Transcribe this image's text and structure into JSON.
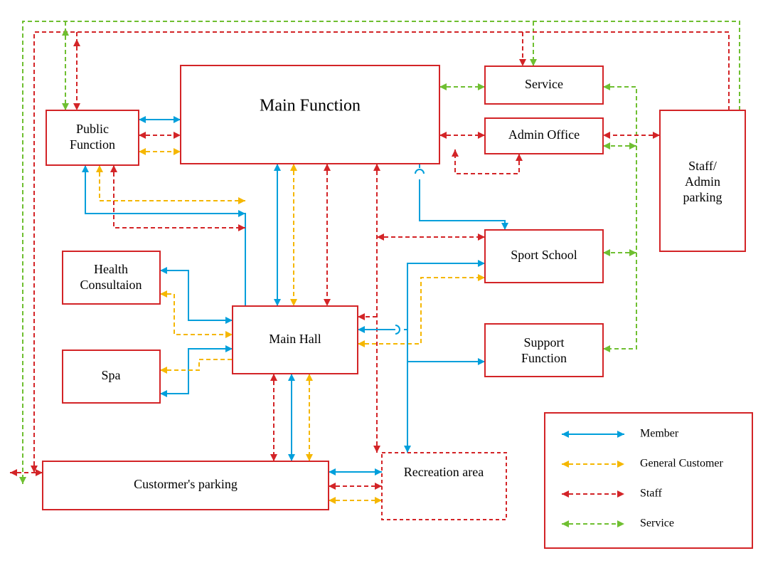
{
  "nodes": {
    "main_function": "Main Function",
    "public_function_l1": "Public",
    "public_function_l2": "Function",
    "service": "Service",
    "admin_office": "Admin Office",
    "staff_parking_l1": "Staff/",
    "staff_parking_l2": "Admin",
    "staff_parking_l3": "parking",
    "sport_school": "Sport School",
    "support_function_l1": "Support",
    "support_function_l2": "Function",
    "main_hall": "Main Hall",
    "health_l1": "Health",
    "health_l2": "Consultaion",
    "spa": "Spa",
    "customers_parking": "Custormer's parking",
    "recreation_area": "Recreation area"
  },
  "legend": {
    "member": "Member",
    "general_customer": "General Customer",
    "staff": "Staff",
    "service": "Service"
  },
  "colors": {
    "member": "#009fdb",
    "general_customer": "#f5b701",
    "staff": "#d32427",
    "service": "#6fbf31"
  }
}
